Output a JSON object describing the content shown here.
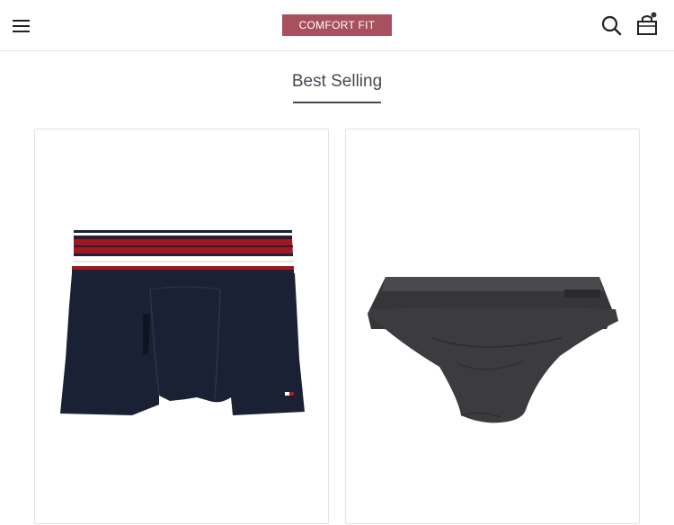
{
  "header": {
    "logo_text": "COMFORT FIT",
    "menu_icon": "hamburger-menu-icon",
    "search_icon": "search-icon",
    "cart_icon": "shopping-bag-icon"
  },
  "section": {
    "title": "Best Selling"
  },
  "products": [
    {
      "image": "boxer-briefs-navy-red-stripe"
    },
    {
      "image": "briefs-charcoal"
    }
  ],
  "colors": {
    "brand": "#a8505d",
    "title_text": "#4e4552"
  }
}
